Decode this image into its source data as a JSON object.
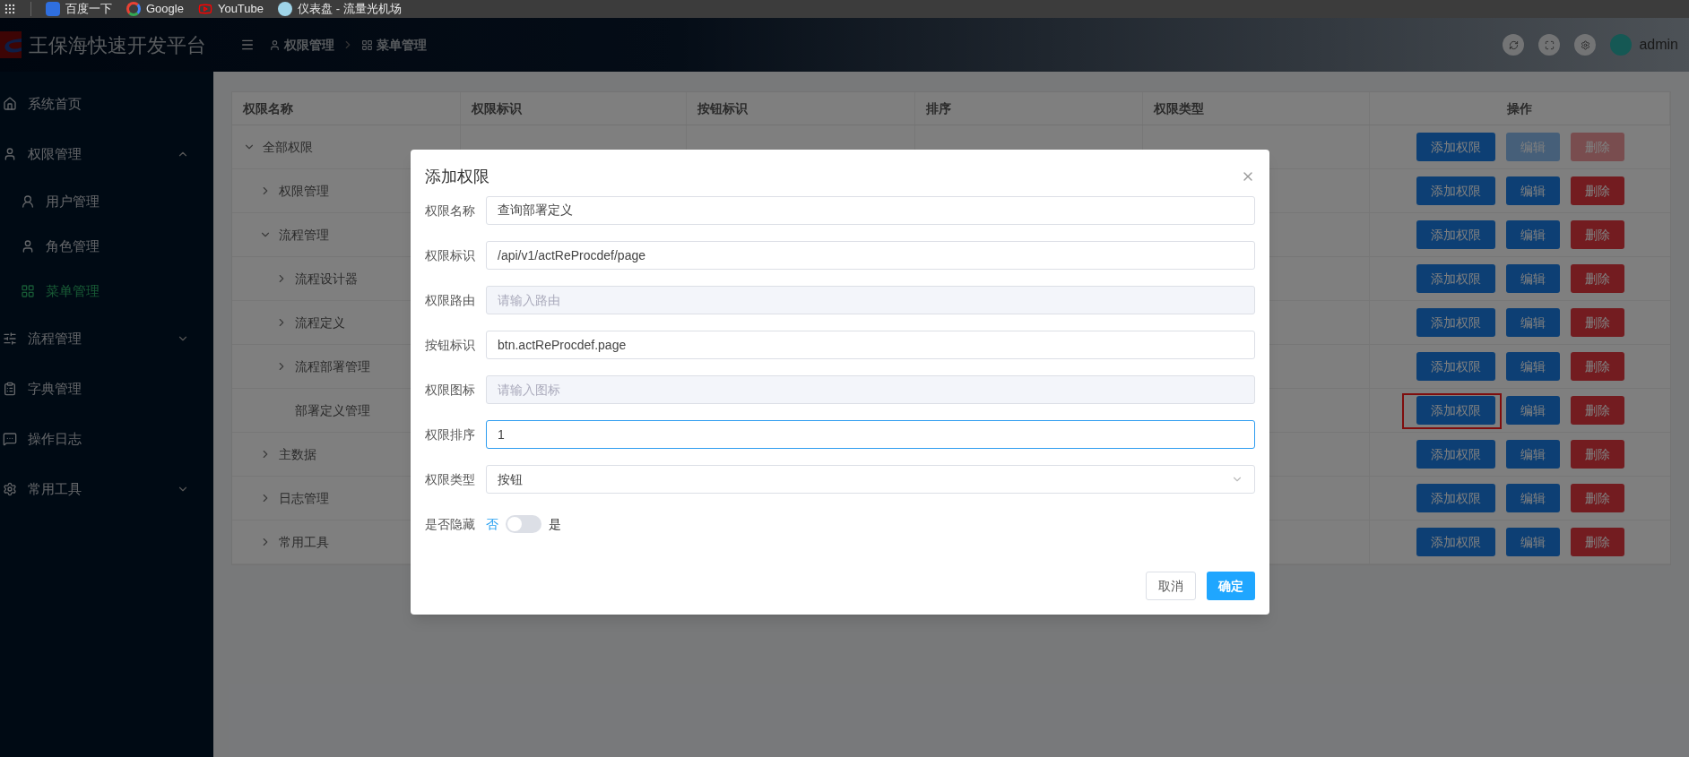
{
  "bookmarks": [
    {
      "label": "百度一下"
    },
    {
      "label": "Google"
    },
    {
      "label": "YouTube"
    },
    {
      "label": "仪表盘 - 流量光机场"
    }
  ],
  "header": {
    "title": "王保海快速开发平台",
    "breadcrumb": [
      "权限管理",
      "菜单管理"
    ],
    "user": "admin"
  },
  "sidebar": {
    "items": [
      {
        "label": "系统首页",
        "selected": false
      },
      {
        "label": "权限管理",
        "selected": false,
        "expanded": true,
        "children": [
          {
            "label": "用户管理",
            "selected": false
          },
          {
            "label": "角色管理",
            "selected": false
          },
          {
            "label": "菜单管理",
            "selected": true
          }
        ]
      },
      {
        "label": "流程管理",
        "selected": false,
        "expanded": false
      },
      {
        "label": "字典管理",
        "selected": false
      },
      {
        "label": "操作日志",
        "selected": false
      },
      {
        "label": "常用工具",
        "selected": false,
        "expanded": false
      }
    ]
  },
  "table": {
    "columns": [
      "权限名称",
      "权限标识",
      "按钮标识",
      "排序",
      "权限类型",
      "操作"
    ],
    "rows": [
      {
        "name": "全部权限",
        "expanded": true,
        "actions": [
          {
            "label": "添加权限",
            "kind": "add",
            "disabled": false,
            "highlighted": false
          },
          {
            "label": "编辑",
            "kind": "edit",
            "disabled": true
          },
          {
            "label": "删除",
            "kind": "delete",
            "disabled": true
          }
        ],
        "children": [
          {
            "name": "权限管理",
            "expanded": false,
            "actions": [
              {
                "label": "添加权限",
                "kind": "add",
                "disabled": false,
                "highlighted": false
              },
              {
                "label": "编辑",
                "kind": "edit",
                "disabled": false
              },
              {
                "label": "删除",
                "kind": "delete",
                "disabled": false
              }
            ]
          },
          {
            "name": "流程管理",
            "expanded": true,
            "actions": [
              {
                "label": "添加权限",
                "kind": "add",
                "disabled": false,
                "highlighted": false
              },
              {
                "label": "编辑",
                "kind": "edit",
                "disabled": false
              },
              {
                "label": "删除",
                "kind": "delete",
                "disabled": false
              }
            ],
            "children": [
              {
                "name": "流程设计器",
                "expanded": false,
                "actions": [
                  {
                    "label": "添加权限",
                    "kind": "add",
                    "disabled": false,
                    "highlighted": false
                  },
                  {
                    "label": "编辑",
                    "kind": "edit",
                    "disabled": false
                  },
                  {
                    "label": "删除",
                    "kind": "delete",
                    "disabled": false
                  }
                ]
              },
              {
                "name": "流程定义",
                "expanded": false,
                "actions": [
                  {
                    "label": "添加权限",
                    "kind": "add",
                    "disabled": false,
                    "highlighted": false
                  },
                  {
                    "label": "编辑",
                    "kind": "edit",
                    "disabled": false
                  },
                  {
                    "label": "删除",
                    "kind": "delete",
                    "disabled": false
                  }
                ]
              },
              {
                "name": "流程部署管理",
                "expanded": false,
                "actions": [
                  {
                    "label": "添加权限",
                    "kind": "add",
                    "disabled": false,
                    "highlighted": false
                  },
                  {
                    "label": "编辑",
                    "kind": "edit",
                    "disabled": false
                  },
                  {
                    "label": "删除",
                    "kind": "delete",
                    "disabled": false
                  }
                ]
              },
              {
                "name": "部署定义管理",
                "actions": [
                  {
                    "label": "添加权限",
                    "kind": "add",
                    "disabled": false,
                    "highlighted": true
                  },
                  {
                    "label": "编辑",
                    "kind": "edit",
                    "disabled": false
                  },
                  {
                    "label": "删除",
                    "kind": "delete",
                    "disabled": false
                  }
                ]
              }
            ]
          },
          {
            "name": "主数据",
            "expanded": false,
            "actions": [
              {
                "label": "添加权限",
                "kind": "add",
                "disabled": false,
                "highlighted": false
              },
              {
                "label": "编辑",
                "kind": "edit",
                "disabled": false
              },
              {
                "label": "删除",
                "kind": "delete",
                "disabled": false
              }
            ]
          },
          {
            "name": "日志管理",
            "expanded": false,
            "actions": [
              {
                "label": "添加权限",
                "kind": "add",
                "disabled": false,
                "highlighted": false
              },
              {
                "label": "编辑",
                "kind": "edit",
                "disabled": false
              },
              {
                "label": "删除",
                "kind": "delete",
                "disabled": false
              }
            ]
          },
          {
            "name": "常用工具",
            "expanded": false,
            "actions": [
              {
                "label": "添加权限",
                "kind": "add",
                "disabled": false,
                "highlighted": false
              },
              {
                "label": "编辑",
                "kind": "edit",
                "disabled": false
              },
              {
                "label": "删除",
                "kind": "delete",
                "disabled": false
              }
            ]
          }
        ]
      }
    ]
  },
  "dialog": {
    "title": "添加权限",
    "fields": [
      {
        "kind": "input",
        "label": "权限名称",
        "value": "查询部署定义",
        "disabled": false,
        "focused": false
      },
      {
        "kind": "input",
        "label": "权限标识",
        "value": "/api/v1/actReProcdef/page",
        "disabled": false,
        "focused": false
      },
      {
        "kind": "input",
        "label": "权限路由",
        "placeholder": "请输入路由",
        "disabled": true,
        "focused": false
      },
      {
        "kind": "input",
        "label": "按钮标识",
        "value": "btn.actReProcdef.page",
        "disabled": false,
        "focused": false
      },
      {
        "kind": "input",
        "label": "权限图标",
        "placeholder": "请输入图标",
        "disabled": true,
        "focused": false
      },
      {
        "kind": "input",
        "label": "权限排序",
        "value": "1",
        "disabled": false,
        "focused": true
      },
      {
        "kind": "select",
        "label": "权限类型",
        "value": "按钮"
      },
      {
        "kind": "switch",
        "label": "是否隐藏",
        "off_label": "否",
        "on_label": "是",
        "on": false
      }
    ],
    "buttons": [
      {
        "label": "取消",
        "kind": "cancel"
      },
      {
        "label": "确定",
        "kind": "confirm"
      }
    ]
  }
}
